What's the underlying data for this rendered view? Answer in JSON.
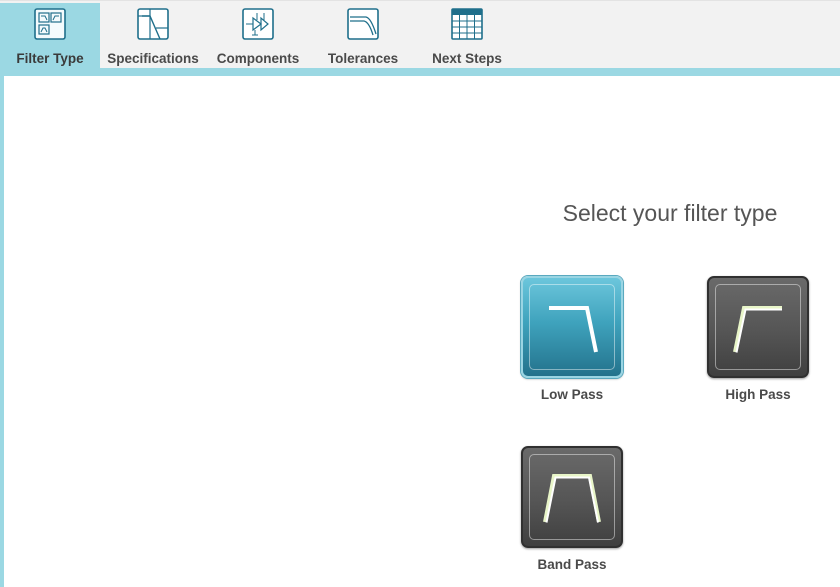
{
  "toolbar": {
    "tabs": [
      {
        "label": "Filter Type",
        "icon": "filter-type-icon",
        "active": true
      },
      {
        "label": "Specifications",
        "icon": "specifications-icon",
        "active": false
      },
      {
        "label": "Components",
        "icon": "components-icon",
        "active": false
      },
      {
        "label": "Tolerances",
        "icon": "tolerances-icon",
        "active": false
      },
      {
        "label": "Next Steps",
        "icon": "next-steps-icon",
        "active": false
      }
    ]
  },
  "main": {
    "heading": "Select your filter type",
    "options": [
      {
        "label": "Low Pass",
        "icon": "low-pass-icon",
        "selected": true
      },
      {
        "label": "High Pass",
        "icon": "high-pass-icon",
        "selected": false
      },
      {
        "label": "Band Pass",
        "icon": "band-pass-icon",
        "selected": false
      }
    ]
  },
  "colors": {
    "accent": "#9bd8e3",
    "icon_stroke": "#1f6f8b",
    "selected_tile": "#3fa3bd",
    "unselected_tile": "#555555"
  }
}
